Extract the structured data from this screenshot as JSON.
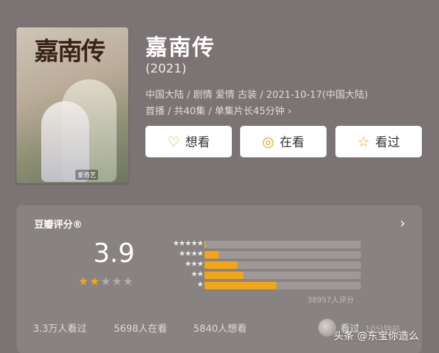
{
  "movie": {
    "title": "嘉南传",
    "year": "(2021)",
    "meta_line1": "中国大陆 / 剧情 爱情 古装 / 2021-10-17(中国大陆)",
    "meta_line2": "首播 / 共40集 / 单集片长45分钟 ›",
    "poster": {
      "title": "嘉南传",
      "logo": "爱奇艺"
    }
  },
  "actions": [
    {
      "label": "想看",
      "icon": "heart-plus-icon",
      "glyph": "♡"
    },
    {
      "label": "在看",
      "icon": "circle-dot-icon",
      "glyph": "◎"
    },
    {
      "label": "看过",
      "icon": "star-icon",
      "glyph": "☆"
    }
  ],
  "rating": {
    "title": "豆瓣评分®",
    "score": "3.9",
    "stars_filled": 2,
    "stars_total": 5,
    "distribution": [
      {
        "stars": "★★★★★",
        "fraction": 0.01
      },
      {
        "stars": "★★★★",
        "fraction": 0.09
      },
      {
        "stars": "★★★",
        "fraction": 0.21
      },
      {
        "stars": "★★",
        "fraction": 0.25
      },
      {
        "stars": "★",
        "fraction": 0.46
      }
    ],
    "votes": "38957人评分"
  },
  "stats": {
    "watched": "3.3万人看过",
    "watching": "5698人在看",
    "want": "5840人想看"
  },
  "user": {
    "note": "看过",
    "note_dim": "10分钟前"
  },
  "watermark": "头条 @东宝你造么",
  "colors": {
    "accent": "#f2a617",
    "background": "#7c7474"
  }
}
